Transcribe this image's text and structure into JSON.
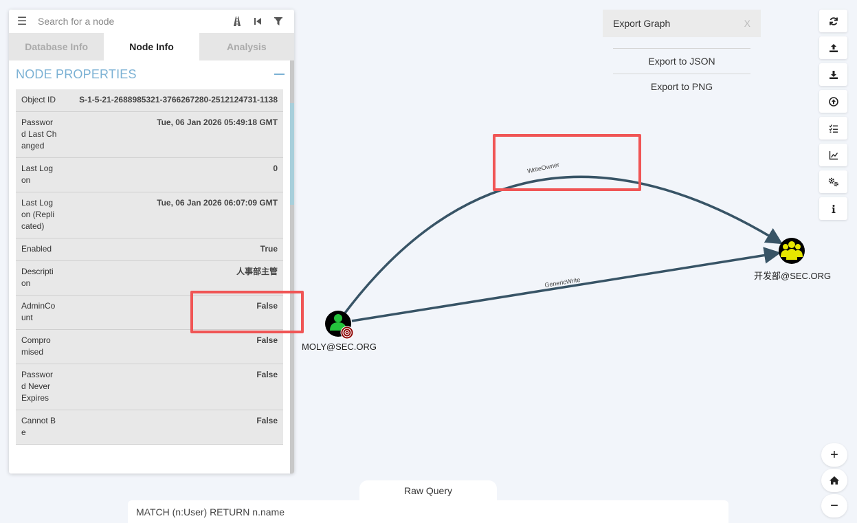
{
  "search": {
    "placeholder": "Search for a node"
  },
  "tabs": [
    {
      "label": "Database Info",
      "active": false
    },
    {
      "label": "Node Info",
      "active": true
    },
    {
      "label": "Analysis",
      "active": false
    }
  ],
  "node_properties": {
    "title": "NODE PROPERTIES",
    "rows": [
      {
        "key": "Object ID",
        "value": "S-1-5-21-2688985321-3766267280-2512124731-1138"
      },
      {
        "key": "Password Last Changed",
        "value": "Tue, 06 Jan 2026 05:49:18 GMT"
      },
      {
        "key": "Last Logon",
        "value": "0"
      },
      {
        "key": "Last Logon (Replicated)",
        "value": "Tue, 06 Jan 2026 06:07:09 GMT"
      },
      {
        "key": "Enabled",
        "value": "True"
      },
      {
        "key": "Description",
        "value": "人事部主管"
      },
      {
        "key": "AdminCount",
        "value": "False"
      },
      {
        "key": "Compromised",
        "value": "False"
      },
      {
        "key": "Password Never Expires",
        "value": "False"
      },
      {
        "key": "Cannot Be",
        "value": "False"
      }
    ]
  },
  "graph": {
    "nodes": {
      "user": {
        "label": "MOLY@SEC.ORG",
        "type": "user"
      },
      "group": {
        "label": "开发部@SEC.ORG",
        "type": "group"
      }
    },
    "edges": [
      {
        "label": "WriteOwner",
        "from": "user",
        "to": "group"
      },
      {
        "label": "GenericWrite",
        "from": "user",
        "to": "group"
      }
    ]
  },
  "export_panel": {
    "title": "Export Graph",
    "close_label": "X",
    "items": [
      "Export to JSON",
      "Export to PNG"
    ]
  },
  "toolbar": {
    "buttons": [
      "refresh-icon",
      "upload-icon",
      "download-icon",
      "import-icon",
      "checklist-icon",
      "chart-icon",
      "settings-icon",
      "info-icon"
    ]
  },
  "zoom_controls": {
    "zoom_in": "+",
    "zoom_out": "−"
  },
  "raw_query": {
    "label": "Raw Query",
    "value": "MATCH (n:User) RETURN n.name"
  },
  "colors": {
    "accent": "#7bb1d4",
    "edge": "#385466",
    "user_node_fill": "#24c33c",
    "group_node_fill": "#e6e600",
    "annotation": "#f05555"
  }
}
